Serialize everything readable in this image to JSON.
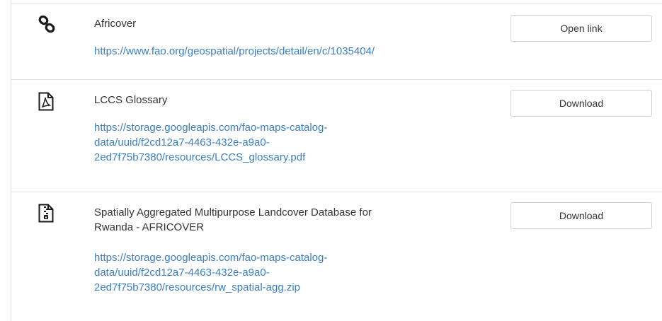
{
  "resources": [
    {
      "icon": "link-icon",
      "title": "Africover",
      "url": "https://www.fao.org/geospatial/projects/detail/en/c/1035404/",
      "button": "Open link"
    },
    {
      "icon": "pdf-file-icon",
      "title": "LCCS Glossary",
      "url_lines": [
        "https://storage.googleapis.com/fao-maps-catalog-",
        "data/uuid/f2cd12a7-4463-432e-a9a0-",
        "2ed7f75b7380/resources/LCCS_glossary.pdf"
      ],
      "button": "Download"
    },
    {
      "icon": "zip-file-icon",
      "title_lines": [
        "Spatially Aggregated Multipurpose Landcover Database for",
        "Rwanda - AFRICOVER"
      ],
      "url_lines": [
        "https://storage.googleapis.com/fao-maps-catalog-",
        "data/uuid/f2cd12a7-4463-432e-a9a0-",
        "2ed7f75b7380/resources/rw_spatial-agg.zip"
      ],
      "button": "Download"
    }
  ],
  "colors": {
    "link": "#3a7fc1",
    "text": "#333333",
    "border": "#cfcfcf"
  }
}
